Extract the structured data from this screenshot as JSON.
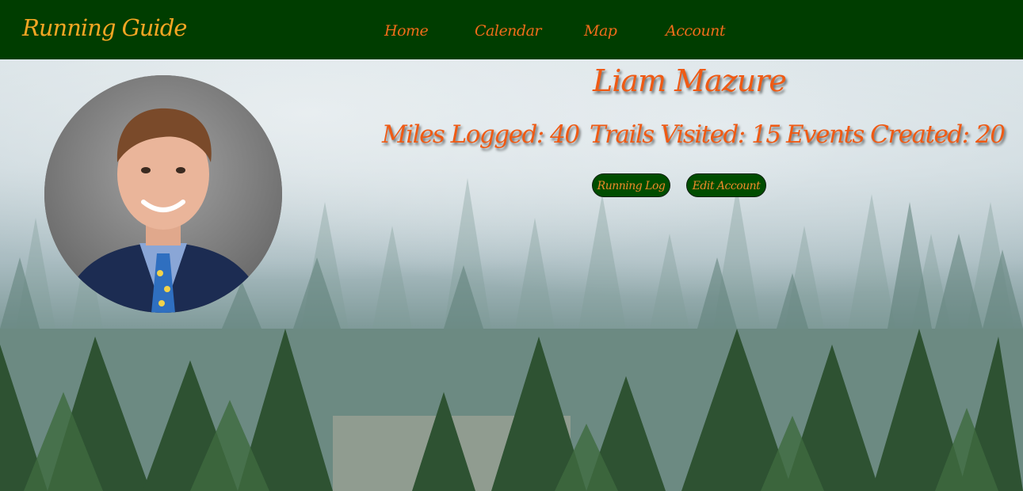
{
  "navbar": {
    "brand": "Running Guide",
    "links": [
      "Home",
      "Calendar",
      "Map",
      "Account"
    ]
  },
  "profile": {
    "name": "Liam Mazure",
    "stats": {
      "miles": "Miles Logged: 40",
      "trails": "Trails Visited: 15",
      "events": "Events Created: 20"
    },
    "buttons": {
      "running_log": "Running Log",
      "edit_account": "Edit Account"
    }
  },
  "colors": {
    "navbar_bg": "#003d00",
    "brand": "#f5a623",
    "accent": "#ef5a14",
    "button_bg": "#004d00"
  }
}
